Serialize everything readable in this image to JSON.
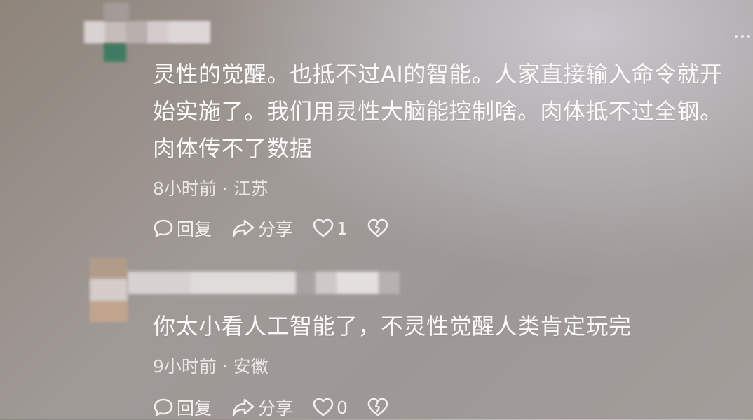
{
  "comments": [
    {
      "text_lines": [
        "灵性的觉醒。也抵不过AI的智能。人家直接输入命令就开",
        "始实施了。我们用灵性大脑能控制啥。肉体抵不过全钢。",
        "肉体传不了数据"
      ],
      "time": "8小时前",
      "location": "江苏",
      "reply_label": "回复",
      "share_label": "分享",
      "like_count": "1"
    },
    {
      "text_lines": [
        "你太小看人工智能了，不灵性觉醒人类肯定玩完"
      ],
      "time": "9小时前",
      "location": "安徽",
      "reply_label": "回复",
      "share_label": "分享",
      "like_count": "0"
    }
  ],
  "separator": " · ",
  "icons": [
    "reply-icon",
    "share-icon",
    "like-heart-icon",
    "dislike-heart-icon",
    "more-icon"
  ]
}
